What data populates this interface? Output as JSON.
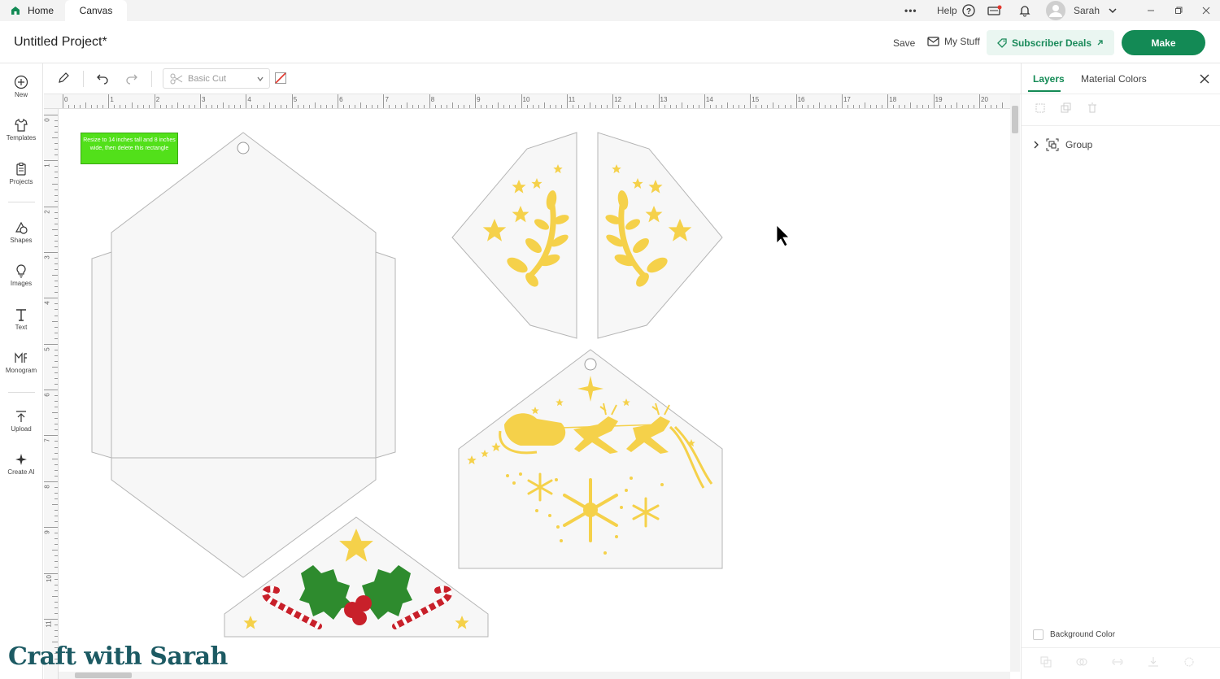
{
  "titlebar": {
    "tabs": [
      {
        "label": "Home"
      },
      {
        "label": "Canvas"
      }
    ],
    "more_label": "•••",
    "help_label": "Help",
    "user_name": "Sarah"
  },
  "header": {
    "project_title": "Untitled Project*",
    "save_label": "Save",
    "mystuff_label": "My Stuff",
    "deals_label": "Subscriber Deals",
    "make_label": "Make"
  },
  "sidebar": {
    "items": [
      {
        "label": "New",
        "icon": "plus-circle-icon"
      },
      {
        "label": "Templates",
        "icon": "shirt-icon"
      },
      {
        "label": "Projects",
        "icon": "clipboard-icon"
      },
      {
        "label": "Shapes",
        "icon": "shapes-icon"
      },
      {
        "label": "Images",
        "icon": "lightbulb-icon"
      },
      {
        "label": "Text",
        "icon": "text-icon"
      },
      {
        "label": "Monogram",
        "icon": "monogram-icon"
      },
      {
        "label": "Upload",
        "icon": "upload-icon"
      },
      {
        "label": "Create AI",
        "icon": "sparkle-icon"
      }
    ]
  },
  "toolbar": {
    "operation_value": "Basic Cut"
  },
  "rulers": {
    "horizontal": [
      "0",
      "1",
      "2",
      "3",
      "4",
      "5",
      "6",
      "7",
      "8",
      "9",
      "10",
      "11",
      "12",
      "13",
      "14",
      "15",
      "16",
      "17",
      "18",
      "19",
      "20"
    ],
    "vertical": [
      "0",
      "1",
      "2",
      "3",
      "4",
      "5",
      "6",
      "7",
      "8",
      "9",
      "10",
      "11"
    ]
  },
  "canvas": {
    "note_text": "Resize to 14 inches tall and 8 inches wide, then delete this rectangle"
  },
  "panel": {
    "tabs": [
      {
        "label": "Layers"
      },
      {
        "label": "Material Colors"
      }
    ],
    "layer_name": "Group",
    "background_label": "Background Color"
  },
  "watermark": "Craft with Sarah",
  "colors": {
    "brand_green": "#138a55",
    "gold": "#f5d14a",
    "holly_green": "#2e8b2e",
    "berry_red": "#c8202a",
    "note_green": "#52e01a"
  }
}
